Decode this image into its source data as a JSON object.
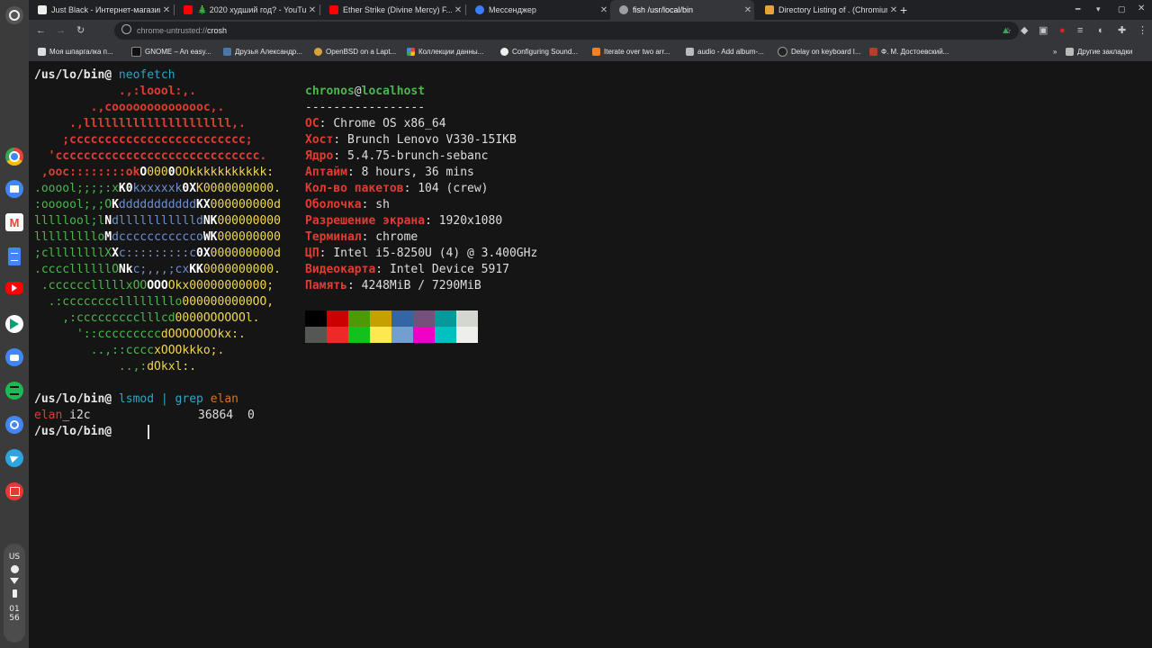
{
  "tabs": [
    {
      "title": "Just Black - Интернет-магазин..."
    },
    {
      "title": "🎄 2020 худший год? - YouTube"
    },
    {
      "title": "Ether Strike (Divine Mercy) F..."
    },
    {
      "title": "Мессенджер"
    },
    {
      "title": "fish /usr/local/bin"
    },
    {
      "title": "Directory Listing of . (Chromium..."
    }
  ],
  "omnibox": {
    "scheme": "chrome-untrusted://",
    "host": "crosh"
  },
  "bookmarks": [
    {
      "label": "Моя шпаргалка п..."
    },
    {
      "label": "GNOME – An easy..."
    },
    {
      "label": "Друзья Александр..."
    },
    {
      "label": "OpenBSD on a Lapt..."
    },
    {
      "label": "Коллекции данны..."
    },
    {
      "label": "Configuring Sound..."
    },
    {
      "label": "Iterate over two arr..."
    },
    {
      "label": "audio - Add album-..."
    },
    {
      "label": "Delay on keyboard l..."
    },
    {
      "label": "Ф. М. Достоевский..."
    },
    {
      "label": "Другие закладки"
    }
  ],
  "terminal": {
    "prompt": "/us/lo/bin@",
    "cmd1": "neofetch",
    "user": "chronos",
    "at": "@",
    "host": "localhost",
    "dashes": "-----------------",
    "info": [
      {
        "label": "ОС",
        "value": "Chrome OS x86_64"
      },
      {
        "label": "Хост",
        "value": "Brunch Lenovo V330-15IKB"
      },
      {
        "label": "Ядро",
        "value": "5.4.75-brunch-sebanc"
      },
      {
        "label": "Аптайм",
        "value": "8 hours, 36 mins"
      },
      {
        "label": "Кол-во пакетов",
        "value": "104 (crew)"
      },
      {
        "label": "Оболочка",
        "value": "sh"
      },
      {
        "label": "Разрешение экрана",
        "value": "1920x1080"
      },
      {
        "label": "Терминал",
        "value": "chrome"
      },
      {
        "label": "ЦП",
        "value": "Intel i5-8250U (4) @ 3.400GHz"
      },
      {
        "label": "Видеокарта",
        "value": "Intel Device 5917"
      },
      {
        "label": "Память",
        "value": "4248MiB / 7290MiB"
      }
    ],
    "palette": [
      "#000000",
      "#cc0000",
      "#4e9a06",
      "#c4a000",
      "#3465a4",
      "#75507b",
      "#06989a",
      "#d3d7cf",
      "#555753",
      "#ef2929",
      "#12c11b",
      "#fce94f",
      "#729fcf",
      "#ee00c8",
      "#00c0c0",
      "#eeeeec"
    ],
    "cmd2": {
      "a": "lsmod",
      "pipe": "|",
      "b": "grep",
      "c": "elan"
    },
    "result": {
      "match": "elan",
      "rest": "_i2c",
      "size": "36864",
      "count": "0"
    }
  },
  "shelf": {
    "lang": "US",
    "time_h": "01",
    "time_m": "56"
  }
}
